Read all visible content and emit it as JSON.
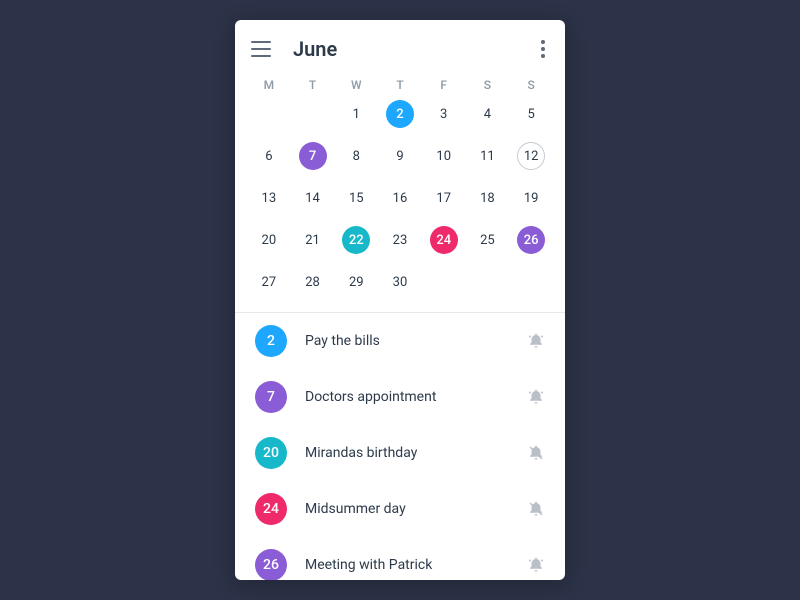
{
  "header": {
    "title": "June"
  },
  "weekdays": [
    "M",
    "T",
    "W",
    "T",
    "F",
    "S",
    "S"
  ],
  "calendar": {
    "leading_blanks": 2,
    "days": [
      {
        "n": 1
      },
      {
        "n": 2,
        "color": "#1ea7ff"
      },
      {
        "n": 3
      },
      {
        "n": 4
      },
      {
        "n": 5
      },
      {
        "n": 6
      },
      {
        "n": 7,
        "color": "#8a5cd6"
      },
      {
        "n": 8
      },
      {
        "n": 9
      },
      {
        "n": 10
      },
      {
        "n": 11
      },
      {
        "n": 12,
        "ring": true
      },
      {
        "n": 13
      },
      {
        "n": 14
      },
      {
        "n": 15
      },
      {
        "n": 16
      },
      {
        "n": 17
      },
      {
        "n": 18
      },
      {
        "n": 19
      },
      {
        "n": 20
      },
      {
        "n": 21
      },
      {
        "n": 22,
        "color": "#17b8c9"
      },
      {
        "n": 23
      },
      {
        "n": 24,
        "color": "#ef2a6a"
      },
      {
        "n": 25
      },
      {
        "n": 26,
        "color": "#8a5cd6"
      },
      {
        "n": 27
      },
      {
        "n": 28
      },
      {
        "n": 29
      },
      {
        "n": 30
      }
    ]
  },
  "events": [
    {
      "day": 2,
      "label": "Pay the bills",
      "color": "#1ea7ff",
      "alert": true
    },
    {
      "day": 7,
      "label": "Doctors appointment",
      "color": "#8a5cd6",
      "alert": true
    },
    {
      "day": 20,
      "label": "Mirandas birthday",
      "color": "#17b8c9",
      "alert": false
    },
    {
      "day": 24,
      "label": "Midsummer day",
      "color": "#ef2a6a",
      "alert": false
    },
    {
      "day": 26,
      "label": "Meeting with Patrick",
      "color": "#8a5cd6",
      "alert": true
    }
  ]
}
